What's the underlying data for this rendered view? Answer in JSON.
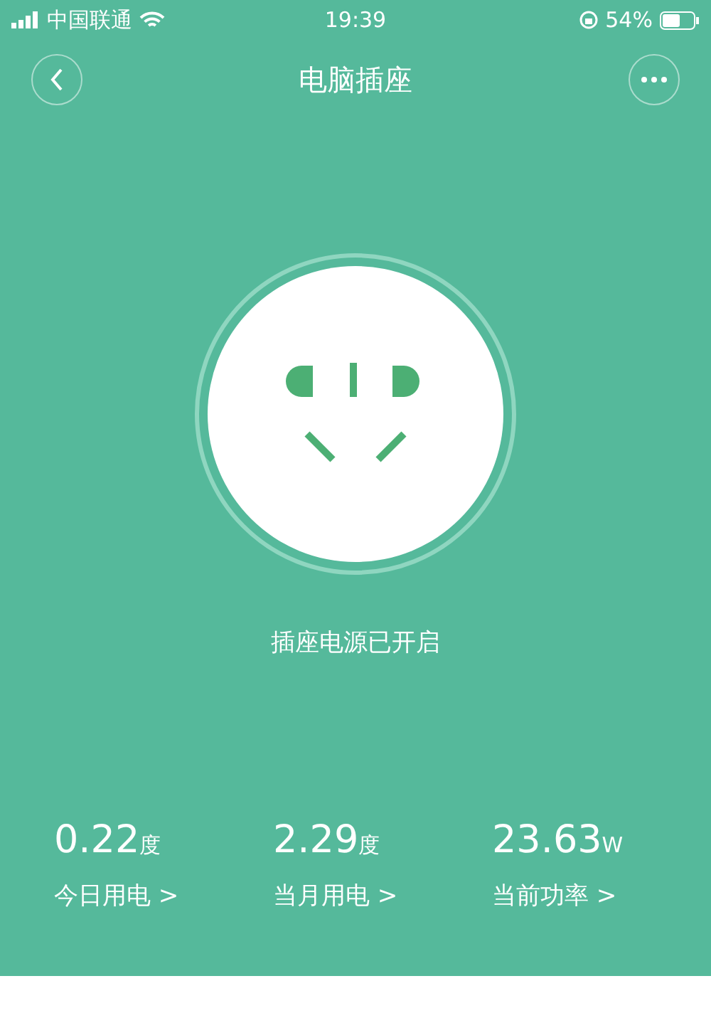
{
  "status_bar": {
    "carrier": "中国联通",
    "time": "19:39",
    "battery": "54%"
  },
  "nav": {
    "title": "电脑插座"
  },
  "socket": {
    "on": true,
    "status": "插座电源已开启"
  },
  "stats": [
    {
      "value": "0.22",
      "unit": "度",
      "label": "今日用电 >"
    },
    {
      "value": "2.29",
      "unit": "度",
      "label": "当月用电 >"
    },
    {
      "value": "23.63",
      "unit": "W",
      "label": "当前功率 >"
    }
  ]
}
